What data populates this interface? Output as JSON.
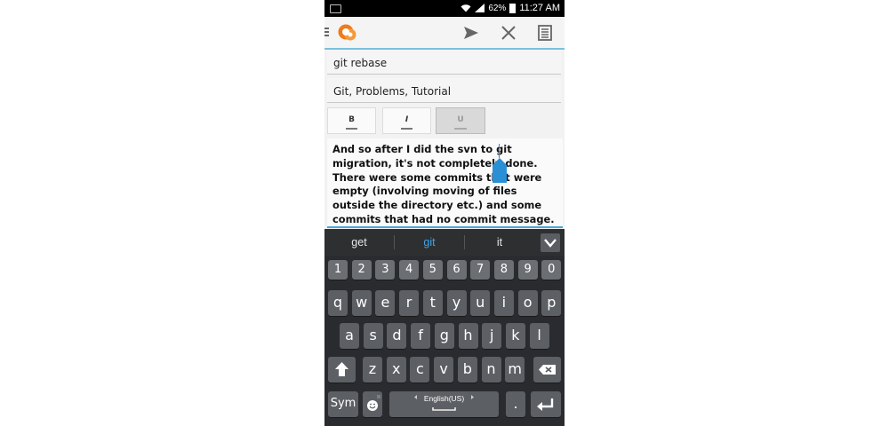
{
  "status_bar": {
    "battery": "62%",
    "time": "11:27 AM"
  },
  "action_bar": {
    "icons": [
      "menu-icon",
      "app-logo-icon",
      "send-icon",
      "close-icon",
      "document-icon"
    ]
  },
  "editor": {
    "title": "git rebase",
    "tags": "Git, Problems, Tutorial",
    "format_buttons": {
      "bold": "B",
      "italic": "I",
      "underline": "U"
    },
    "body": "And so after I did the svn to git migration, it's not completely done. There were some commits that were empty (involving moving of files outside the directory etc.) and some commits that had no commit message."
  },
  "keyboard": {
    "suggestions": [
      "get",
      "git",
      "it"
    ],
    "selected_suggestion": "git",
    "number_row": [
      "1",
      "2",
      "3",
      "4",
      "5",
      "6",
      "7",
      "8",
      "9",
      "0"
    ],
    "row1": [
      "q",
      "w",
      "e",
      "r",
      "t",
      "y",
      "u",
      "i",
      "o",
      "p"
    ],
    "row2": [
      "a",
      "s",
      "d",
      "f",
      "g",
      "h",
      "j",
      "k",
      "l"
    ],
    "row3": [
      "z",
      "x",
      "c",
      "v",
      "b",
      "n",
      "m"
    ],
    "sym_label": "Sym",
    "language": "English(US)",
    "period": ".",
    "colors": {
      "accent": "#3fa6e6",
      "key": "#5c5f63",
      "keyboard_bg": "#2a2b2e"
    }
  }
}
